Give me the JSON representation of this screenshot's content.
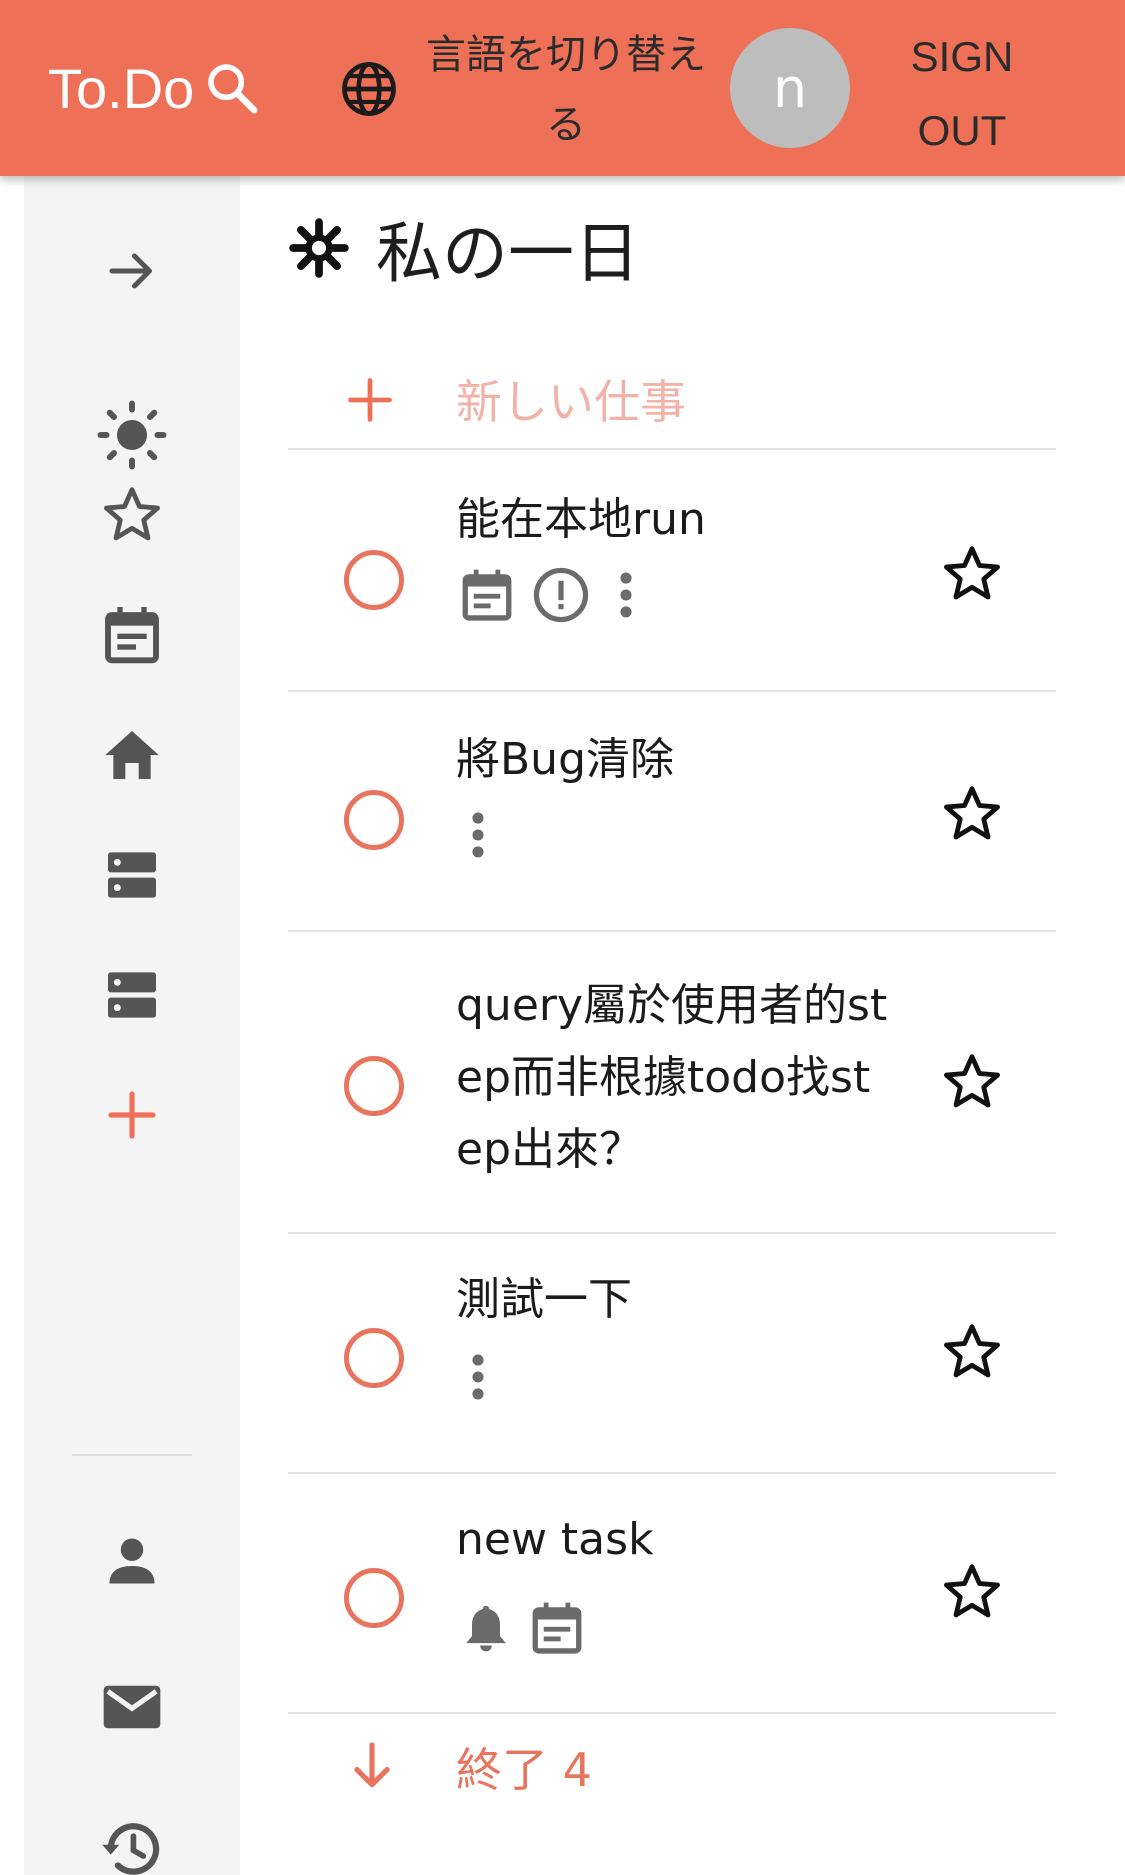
{
  "header": {
    "brand": "To.Do",
    "language_button": "言語を切り替える",
    "avatar_initial": "n",
    "sign_out": "SIGN OUT"
  },
  "sidebar": {
    "items": [
      {
        "icon": "arrow-right-icon"
      },
      {
        "icon": "sun-icon"
      },
      {
        "icon": "star-outline-icon"
      },
      {
        "icon": "calendar-icon"
      },
      {
        "icon": "home-icon"
      },
      {
        "icon": "list-icon"
      },
      {
        "icon": "list-icon"
      },
      {
        "icon": "plus-icon"
      },
      {
        "icon": "person-icon"
      },
      {
        "icon": "mail-icon"
      },
      {
        "icon": "history-icon"
      }
    ]
  },
  "main": {
    "title": "私の一日",
    "title_icon": "sun-asterisk-icon",
    "new_task_placeholder": "新しい仕事",
    "tasks": [
      {
        "title": "能在本地run",
        "icons": [
          "calendar-icon",
          "important-icon",
          "more-vert-icon"
        ]
      },
      {
        "title": "將Bug清除",
        "icons": [
          "more-vert-icon"
        ]
      },
      {
        "title": "query屬於使用者的step而非根據todo找step出來？",
        "icons": []
      },
      {
        "title": "測試一下",
        "icons": [
          "more-vert-icon"
        ]
      },
      {
        "title": "new task",
        "icons": [
          "bell-icon",
          "calendar-icon"
        ]
      }
    ],
    "completed_label": "終了 4"
  },
  "colors": {
    "accent": "#ee7057",
    "circle": "#e9745d",
    "sidebar_bg": "#f4f4f4",
    "icon_gray": "#5f5f5f",
    "placeholder": "#f1b3a7"
  }
}
